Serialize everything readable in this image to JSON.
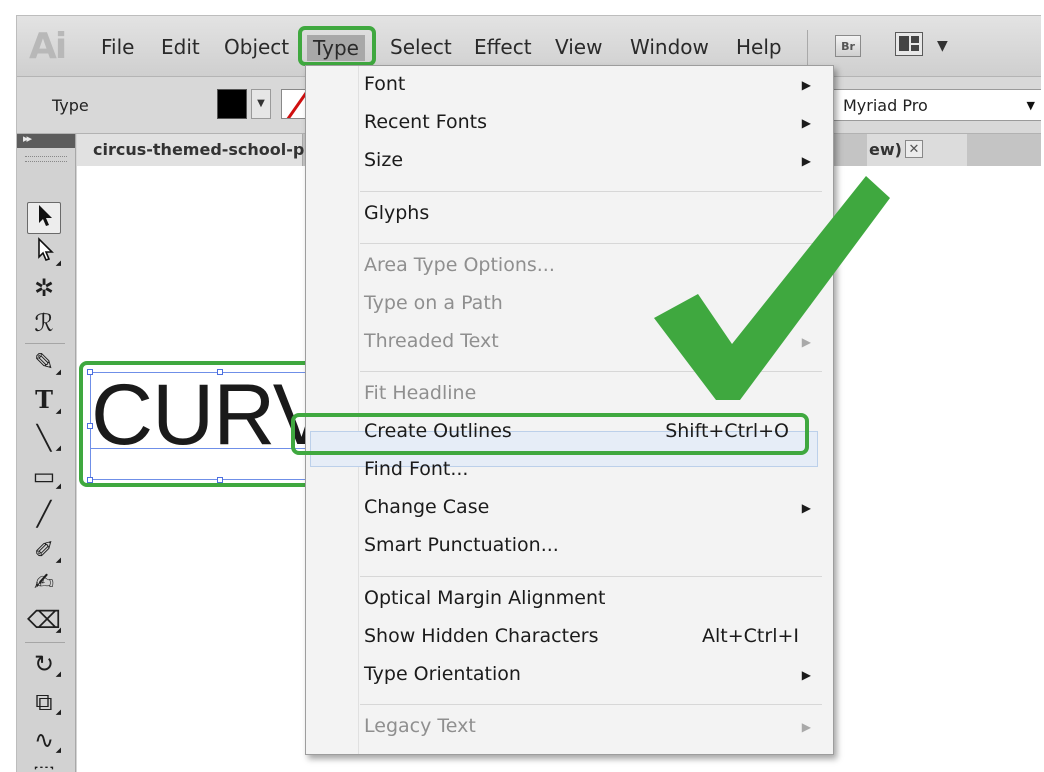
{
  "app_logo": "Ai",
  "menubar": {
    "items": [
      "File",
      "Edit",
      "Object",
      "Type",
      "Select",
      "Effect",
      "View",
      "Window",
      "Help"
    ],
    "bridge_label": "Br"
  },
  "control_bar": {
    "label": "Type",
    "font_name": "Myriad Pro"
  },
  "tabs": {
    "document": "circus-themed-school-p",
    "right_fragment": "ew)",
    "close_label": "✕"
  },
  "canvas": {
    "text": "CURV"
  },
  "type_menu": {
    "items": [
      {
        "label": "Font",
        "submenu": true,
        "disabled": false
      },
      {
        "label": "Recent Fonts",
        "submenu": true,
        "disabled": false
      },
      {
        "label": "Size",
        "submenu": true,
        "disabled": false
      },
      {
        "label": "Glyphs",
        "submenu": false,
        "disabled": false
      },
      {
        "label": "Area Type Options...",
        "submenu": false,
        "disabled": true
      },
      {
        "label": "Type on a Path",
        "submenu": true,
        "disabled": true
      },
      {
        "label": "Threaded Text",
        "submenu": true,
        "disabled": true
      },
      {
        "label": "Fit Headline",
        "submenu": false,
        "disabled": true
      },
      {
        "label": "Create Outlines",
        "shortcut": "Shift+Ctrl+O",
        "submenu": false,
        "disabled": false,
        "highlighted": true
      },
      {
        "label": "Find Font...",
        "submenu": false,
        "disabled": false
      },
      {
        "label": "Change Case",
        "submenu": true,
        "disabled": false
      },
      {
        "label": "Smart Punctuation...",
        "submenu": false,
        "disabled": false
      },
      {
        "label": "Optical Margin Alignment",
        "submenu": false,
        "disabled": false
      },
      {
        "label": "Show Hidden Characters",
        "shortcut": "Alt+Ctrl+I",
        "submenu": false,
        "disabled": false
      },
      {
        "label": "Type Orientation",
        "submenu": true,
        "disabled": false
      },
      {
        "label": "Legacy Text",
        "submenu": true,
        "disabled": true
      }
    ]
  },
  "icons": {
    "submenu_arrow": "▶",
    "dropdown_arrow": "▼"
  },
  "colors": {
    "highlight_green": "#3fa83f",
    "menu_bg": "#f3f3f3",
    "disabled_text": "#8f8f8f"
  }
}
